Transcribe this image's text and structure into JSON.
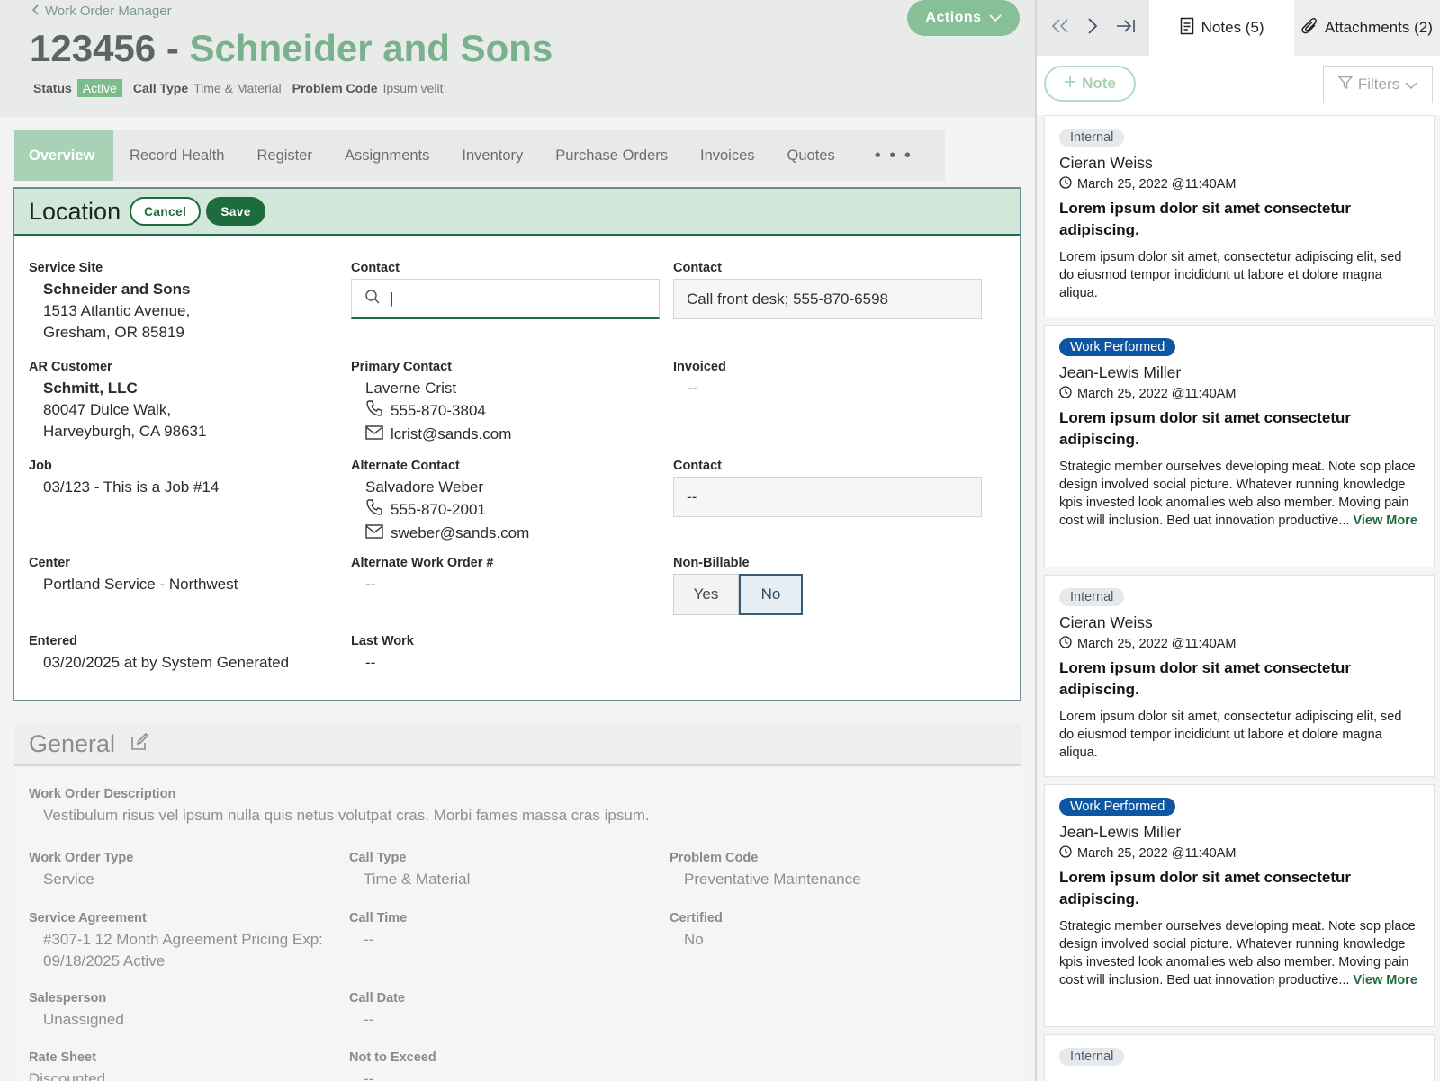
{
  "header": {
    "back_label": "Work Order Manager",
    "wo_number": "123456",
    "title_sep": " - ",
    "customer_name": "Schneider and Sons",
    "status_label": "Status",
    "status_value": "Active",
    "call_type_label": "Call Type",
    "call_type_value": "Time & Material",
    "problem_code_label": "Problem Code",
    "problem_code_value": "Ipsum velit",
    "actions_label": "Actions"
  },
  "tabs": [
    {
      "label": "Overview"
    },
    {
      "label": "Record Health"
    },
    {
      "label": "Register"
    },
    {
      "label": "Assignments"
    },
    {
      "label": "Inventory"
    },
    {
      "label": "Purchase Orders"
    },
    {
      "label": "Invoices"
    },
    {
      "label": "Quotes"
    },
    {
      "label": "• • •"
    }
  ],
  "location": {
    "title": "Location",
    "cancel_label": "Cancel",
    "save_label": "Save",
    "service_site": {
      "label": "Service Site",
      "name": "Schneider and Sons",
      "line1": "1513 Atlantic Avenue,",
      "line2": "Gresham, OR 85819"
    },
    "contact_search": {
      "label": "Contact",
      "value": "|"
    },
    "contact_note": {
      "label": "Contact",
      "value": "Call front desk; 555-870-6598"
    },
    "ar_customer": {
      "label": "AR Customer",
      "name": "Schmitt, LLC",
      "line1": "80047 Dulce Walk,",
      "line2": "Harveyburgh, CA 98631"
    },
    "primary_contact": {
      "label": "Primary Contact",
      "name": "Laverne Crist",
      "phone": "555-870-3804",
      "email": "lcrist@sands.com"
    },
    "invoiced": {
      "label": "Invoiced",
      "value": "--"
    },
    "job": {
      "label": "Job",
      "value": "03/123 - This is a Job #14"
    },
    "alternate_contact": {
      "label": "Alternate Contact",
      "name": "Salvadore Weber",
      "phone": "555-870-2001",
      "email": "sweber@sands.com"
    },
    "contact_alt": {
      "label": "Contact",
      "value": "--"
    },
    "center": {
      "label": "Center",
      "value": "Portland Service - Northwest"
    },
    "alt_work_order": {
      "label": "Alternate Work Order #",
      "value": "--"
    },
    "non_billable": {
      "label": "Non-Billable",
      "yes": "Yes",
      "no": "No",
      "selected": "No"
    },
    "entered": {
      "label": "Entered",
      "value": "03/20/2025 at by System Generated"
    },
    "last_work": {
      "label": "Last Work",
      "value": "--"
    }
  },
  "general": {
    "title": "General",
    "description": {
      "label": "Work Order Description",
      "value": "Vestibulum risus vel ipsum nulla quis netus volutpat cras. Morbi fames massa cras ipsum."
    },
    "work_order_type": {
      "label": "Work Order Type",
      "value": "Service"
    },
    "call_type": {
      "label": "Call Type",
      "value": "Time & Material"
    },
    "problem_code": {
      "label": "Problem Code",
      "value": "Preventative Maintenance"
    },
    "service_agreement": {
      "label": "Service Agreement",
      "line1": "#307-1 12 Month Agreement Pricing Exp:",
      "line2": "09/18/2025 Active"
    },
    "call_time": {
      "label": "Call Time",
      "value": "--"
    },
    "certified": {
      "label": "Certified",
      "value": "No"
    },
    "salesperson": {
      "label": "Salesperson",
      "value": "Unassigned"
    },
    "call_date": {
      "label": "Call Date",
      "value": "--"
    },
    "rate_sheet": {
      "label": "Rate Sheet",
      "value": "Discounted"
    },
    "not_to_exceed": {
      "label": "Not to Exceed",
      "value": "--"
    }
  },
  "panel": {
    "notes_tab": "Notes (5)",
    "attachments_tab": "Attachments (2)",
    "add_note_label": "Note",
    "filters_label": "Filters",
    "view_more": "View More",
    "notes": [
      {
        "tag": "Internal",
        "author": "Cieran Weiss",
        "date": "March 25, 2022 @11:40AM",
        "subject": "Lorem ipsum dolor sit amet consectetur adipiscing.",
        "body": "Lorem ipsum dolor sit amet, consectetur adipiscing elit, sed do eiusmod tempor incididunt ut labore et dolore magna aliqua."
      },
      {
        "tag": "Work Performed",
        "author": "Jean-Lewis Miller",
        "date": "March 25, 2022 @11:40AM",
        "subject": "Lorem ipsum dolor sit amet consectetur adipiscing.",
        "body": "Strategic member ourselves developing meat. Note sop place design involved social picture. Whatever running knowledge kpis invested look anomalies web also member. Moving pain cost will inclusion. Bed uat innovation productive..."
      },
      {
        "tag": "Internal",
        "author": "Cieran Weiss",
        "date": "March 25, 2022 @11:40AM",
        "subject": "Lorem ipsum dolor sit amet consectetur adipiscing.",
        "body": "Lorem ipsum dolor sit amet, consectetur adipiscing elit, sed do eiusmod tempor incididunt ut labore et dolore magna aliqua."
      },
      {
        "tag": "Work Performed",
        "author": "Jean-Lewis Miller",
        "date": "March 25, 2022 @11:40AM",
        "subject": "Lorem ipsum dolor sit amet consectetur adipiscing.",
        "body": "Strategic member ourselves developing meat. Note sop place design involved social picture. Whatever running knowledge kpis invested look anomalies web also member. Moving pain cost will inclusion. Bed uat innovation productive..."
      },
      {
        "tag": "Internal"
      }
    ]
  },
  "colors": {
    "accent": "#79b18d",
    "primary_dark": "#1e6b3e",
    "work_tag": "#0e56a2"
  }
}
